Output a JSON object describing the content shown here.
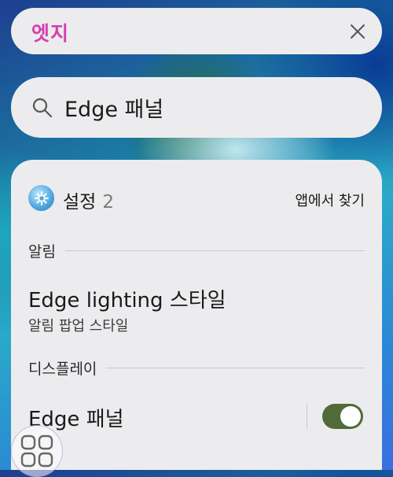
{
  "app_bar": {
    "title": "엣지"
  },
  "search": {
    "query": "Edge 패널"
  },
  "results": {
    "app_name": "설정",
    "count": "2",
    "find_in_app": "앱에서 찾기",
    "sections": [
      {
        "header": "알림",
        "item": {
          "title": "Edge lighting 스타일",
          "subtitle": "알림 팝업 스타일"
        }
      },
      {
        "header": "디스플레이",
        "item": {
          "title": "Edge 패널",
          "toggle_on": true
        }
      }
    ]
  },
  "colors": {
    "accent_title": "#d63fb0",
    "toggle_on": "#4f6b3a"
  },
  "icons": {
    "close": "close-icon",
    "search": "search-icon",
    "settings": "settings-app-icon",
    "home": "apps-grid-icon"
  }
}
